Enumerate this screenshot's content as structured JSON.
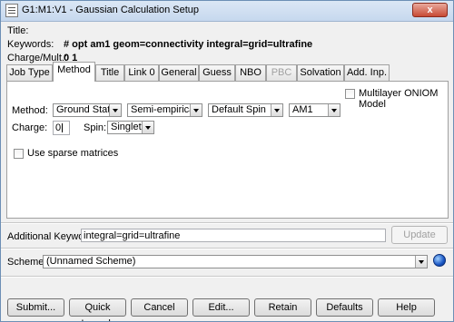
{
  "window": {
    "title": "G1:M1:V1 - Gaussian Calculation Setup",
    "close": "x"
  },
  "header": {
    "title_label": "Title:",
    "keywords_label": "Keywords:",
    "keywords_value": "# opt am1 geom=connectivity integral=grid=ultrafine",
    "charge_mult_label": "Charge/Mult.:",
    "charge_mult_value": "0 1"
  },
  "tabs": [
    {
      "label": "Job Type",
      "active": false,
      "disabled": false
    },
    {
      "label": "Method",
      "active": true,
      "disabled": false
    },
    {
      "label": "Title",
      "active": false,
      "disabled": false
    },
    {
      "label": "Link 0",
      "active": false,
      "disabled": false
    },
    {
      "label": "General",
      "active": false,
      "disabled": false
    },
    {
      "label": "Guess",
      "active": false,
      "disabled": false
    },
    {
      "label": "NBO",
      "active": false,
      "disabled": false
    },
    {
      "label": "PBC",
      "active": false,
      "disabled": true
    },
    {
      "label": "Solvation",
      "active": false,
      "disabled": false
    },
    {
      "label": "Add. Inp.",
      "active": false,
      "disabled": false
    }
  ],
  "method_tab": {
    "oniom_label": "Multilayer ONIOM Model",
    "oniom_checked": false,
    "method_label": "Method:",
    "method_state": "Ground State",
    "method_type": "Semi-empirical...",
    "method_spin_mode": "Default Spin",
    "method_name": "AM1",
    "charge_label": "Charge:",
    "charge_value": "0",
    "spin_label": "Spin:",
    "spin_value": "Singlet",
    "sparse_label": "Use sparse matrices",
    "sparse_checked": false
  },
  "additional": {
    "label": "Additional Keywords:",
    "value": "integral=grid=ultrafine",
    "update_button": "Update"
  },
  "scheme": {
    "label": "Scheme:",
    "value": "(Unnamed Scheme)"
  },
  "buttons": {
    "submit": "Submit...",
    "quick_launch": "Quick Launch",
    "cancel": "Cancel",
    "edit": "Edit...",
    "retain": "Retain",
    "defaults": "Defaults",
    "help": "Help"
  }
}
